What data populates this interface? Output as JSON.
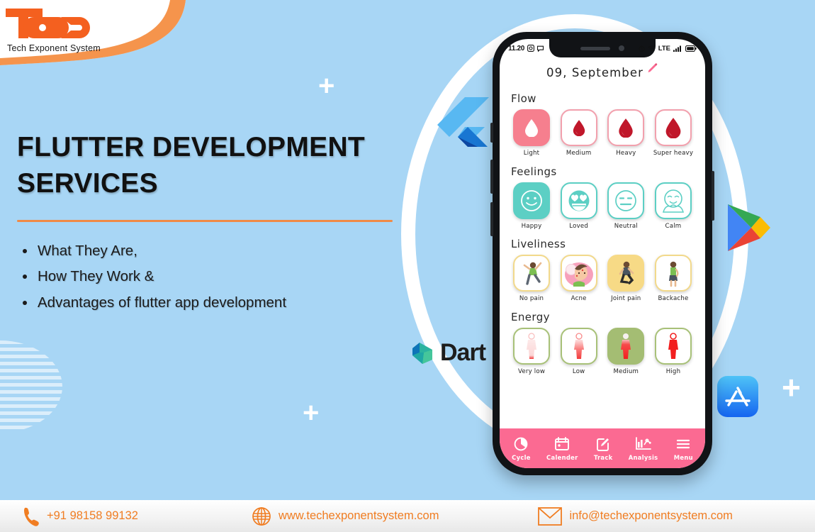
{
  "brand": {
    "logo_text": "TES",
    "logo_subtitle": "Tech Exponent System",
    "accent_orange": "#f07d22",
    "background_blue": "#a8d6f5"
  },
  "hero": {
    "headline": "FLUTTER DEVELOPMENT SERVICES",
    "bullets": [
      "What They Are,",
      "How They Work &",
      "Advantages of flutter app development"
    ]
  },
  "tech_logos": [
    {
      "name": "flutter-logo",
      "label": ""
    },
    {
      "name": "dart-logo",
      "label": "Dart"
    },
    {
      "name": "google-play-logo",
      "label": ""
    },
    {
      "name": "app-store-logo",
      "label": ""
    }
  ],
  "phone": {
    "status_bar": {
      "time": "11.20",
      "network": "LTE",
      "icons": [
        "camera-icon",
        "message-icon",
        "alarm-icon",
        "wifi-icon",
        "signal-icon",
        "battery-icon"
      ]
    },
    "date": "09, September",
    "edit_icon": "pencil-icon",
    "sections": [
      {
        "title": "Flow",
        "accent": "#f2a0ad",
        "items": [
          {
            "label": "Light",
            "icon": "droplet-icon",
            "selected": true
          },
          {
            "label": "Medium",
            "icon": "droplet-icon",
            "selected": false
          },
          {
            "label": "Heavy",
            "icon": "droplet-icon",
            "selected": false
          },
          {
            "label": "Super heavy",
            "icon": "droplet-icon",
            "selected": false
          }
        ]
      },
      {
        "title": "Feelings",
        "accent": "#5ccfc4",
        "items": [
          {
            "label": "Happy",
            "icon": "smile-face-icon",
            "selected": true
          },
          {
            "label": "Loved",
            "icon": "heart-eyes-face-icon",
            "selected": false
          },
          {
            "label": "Neutral",
            "icon": "neutral-face-icon",
            "selected": false
          },
          {
            "label": "Calm",
            "icon": "calm-face-icon",
            "selected": false
          }
        ]
      },
      {
        "title": "Liveliness",
        "accent": "#f2d98b",
        "items": [
          {
            "label": "No pain",
            "icon": "jumping-person-icon",
            "selected": false
          },
          {
            "label": "Acne",
            "icon": "face-acne-icon",
            "selected": false
          },
          {
            "label": "Joint pain",
            "icon": "kneeling-person-icon",
            "selected": true
          },
          {
            "label": "Backache",
            "icon": "standing-person-icon",
            "selected": false
          }
        ]
      },
      {
        "title": "Energy",
        "accent": "#a8c178",
        "items": [
          {
            "label": "Very low",
            "icon": "body-figure-icon",
            "selected": false
          },
          {
            "label": "Low",
            "icon": "body-figure-icon",
            "selected": false
          },
          {
            "label": "Medium",
            "icon": "body-figure-icon",
            "selected": true
          },
          {
            "label": "High",
            "icon": "body-figure-icon",
            "selected": false
          }
        ]
      }
    ],
    "tabs": [
      {
        "label": "Cycle",
        "icon": "cycle-icon"
      },
      {
        "label": "Calender",
        "icon": "calendar-icon"
      },
      {
        "label": "Track",
        "icon": "edit-square-icon"
      },
      {
        "label": "Analysis",
        "icon": "chart-icon"
      },
      {
        "label": "Menu",
        "icon": "hamburger-icon"
      }
    ],
    "tabbar_color": "#fb6a92"
  },
  "footer": {
    "phone": "+91 98158 99132",
    "website": "www.techexponentsystem.com",
    "email": "info@techexponentsystem.com",
    "icons": [
      "phone-icon",
      "globe-icon",
      "envelope-icon"
    ]
  }
}
